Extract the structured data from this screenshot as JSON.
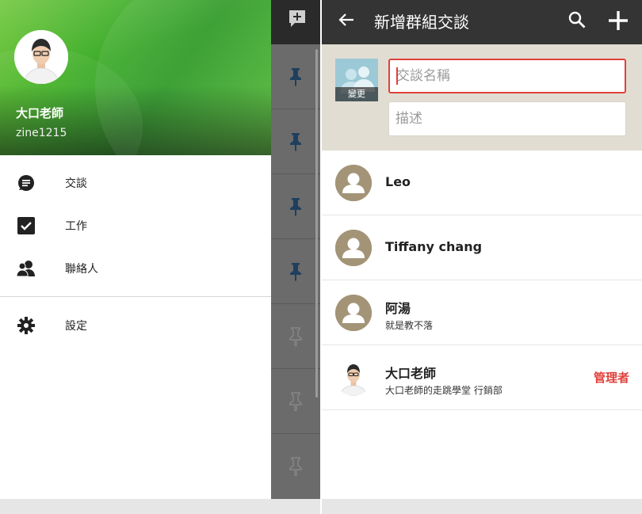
{
  "left_screen": {
    "profile": {
      "name": "大口老師",
      "user_id": "zine1215",
      "header_color": "#3fae2a"
    },
    "menu": [
      {
        "label": "交談",
        "icon": "chat-bubble-icon"
      },
      {
        "label": "工作",
        "icon": "checkbox-icon"
      },
      {
        "label": "聯絡人",
        "icon": "contacts-icon"
      },
      {
        "label": "設定",
        "icon": "gear-icon"
      }
    ],
    "background_list": {
      "compose_icon": "compose-chat-icon",
      "pins": [
        {
          "state": "pinned"
        },
        {
          "state": "pinned"
        },
        {
          "state": "pinned"
        },
        {
          "state": "pinned"
        },
        {
          "state": "unpinned"
        },
        {
          "state": "unpinned"
        },
        {
          "state": "unpinned"
        }
      ]
    }
  },
  "right_screen": {
    "app_bar": {
      "title": "新增群組交談",
      "back_icon": "arrow-left-icon",
      "search_icon": "search-icon",
      "add_icon": "plus-icon"
    },
    "form": {
      "change_photo_label": "變更",
      "name_placeholder": "交談名稱",
      "description_placeholder": "描述",
      "accent_color": "#e0403a"
    },
    "members": [
      {
        "name": "Leo",
        "subtitle": "",
        "role": ""
      },
      {
        "name": "Tiffany chang",
        "subtitle": "",
        "role": ""
      },
      {
        "name": "阿湯",
        "subtitle": "就是教不落",
        "role": ""
      },
      {
        "name": "大口老師",
        "subtitle": "大口老師的走跳學堂 行銷部",
        "role": "管理者"
      }
    ]
  }
}
